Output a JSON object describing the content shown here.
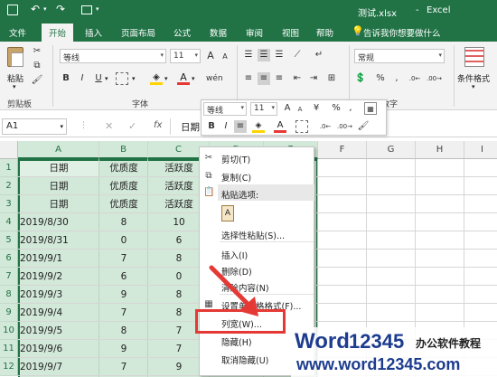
{
  "title": {
    "filename": "测试.xlsx",
    "sep": "-",
    "app": "Excel"
  },
  "tabs": [
    "文件",
    "开始",
    "插入",
    "页面布局",
    "公式",
    "数据",
    "审阅",
    "视图",
    "帮助"
  ],
  "tell_me": "告诉我你想要做什么",
  "ribbon": {
    "paste_label": "粘贴",
    "font_name": "等线",
    "font_size": "11",
    "number_format": "常规",
    "conditional_format": "条件格式",
    "group_clipboard": "剪贴板",
    "group_font": "字体",
    "group_number": "数字",
    "bold": "B",
    "italic": "I",
    "underline": "U",
    "font_color_letter": "A",
    "grow": "A",
    "shrink": "A"
  },
  "formula_bar": {
    "name_box": "A1",
    "fx": "fx",
    "content": "日期"
  },
  "mini_toolbar": {
    "font_name": "等线",
    "font_size": "11",
    "bold": "B",
    "italic": "I",
    "currency": "¥",
    "percent": "%",
    "comma": ","
  },
  "columns": [
    "A",
    "B",
    "C",
    "D",
    "E",
    "F",
    "G",
    "H",
    "I"
  ],
  "rows": [
    "1",
    "2",
    "3",
    "4",
    "5",
    "6",
    "7",
    "8",
    "9",
    "10",
    "11",
    "12"
  ],
  "cells": [
    [
      "日期",
      "优质度",
      "活跃度"
    ],
    [
      "日期",
      "优质度",
      "活跃度"
    ],
    [
      "日期",
      "优质度",
      "活跃度"
    ],
    [
      "2019/8/30",
      "8",
      "10"
    ],
    [
      "2019/8/31",
      "0",
      "6"
    ],
    [
      "2019/9/1",
      "7",
      "8"
    ],
    [
      "2019/9/2",
      "6",
      "0"
    ],
    [
      "2019/9/3",
      "9",
      "8"
    ],
    [
      "2019/9/4",
      "7",
      "8"
    ],
    [
      "2019/9/5",
      "8",
      "7"
    ],
    [
      "2019/9/6",
      "9",
      "7"
    ],
    [
      "2019/9/7",
      "7",
      "9"
    ]
  ],
  "context_menu": {
    "cut": "剪切(T)",
    "copy": "复制(C)",
    "paste_options": "粘贴选项:",
    "paste_special": "选择性粘贴(S)...",
    "insert": "插入(I)",
    "delete": "删除(D)",
    "clear": "清除内容(N)",
    "format_cells": "设置单元格格式(F)...",
    "column_width": "列宽(W)...",
    "hide": "隐藏(H)",
    "unhide": "取消隐藏(U)"
  },
  "watermark": {
    "brand_word": "Word",
    "brand_num": "12345",
    "slogan": "办公软件教程",
    "url": "www.word12345.com"
  },
  "colors": {
    "excel_green": "#217346",
    "selection": "#d2e8d8",
    "highlight_box": "#e53935",
    "arrow": "#e53935"
  },
  "icons": [
    "save-icon",
    "undo-icon",
    "redo-icon",
    "customize-icon",
    "lightbulb-icon",
    "cut-icon",
    "copy-icon",
    "paste-icon",
    "format-painter-icon",
    "format-cells-icon"
  ]
}
